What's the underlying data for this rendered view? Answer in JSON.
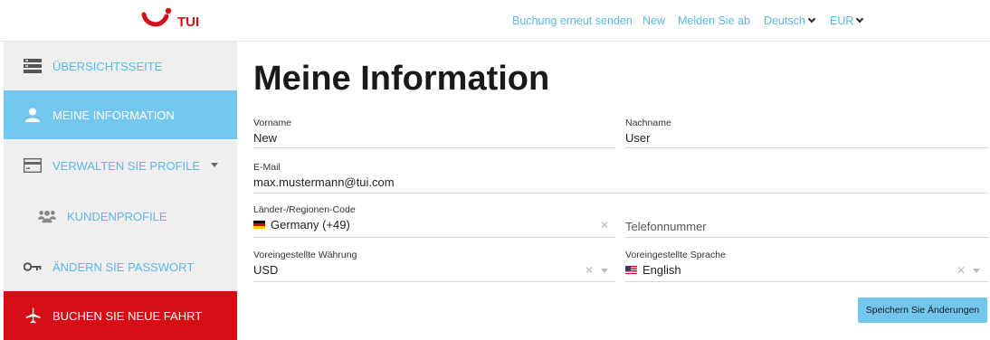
{
  "brand": {
    "name": "TUI",
    "color": "#d40e14"
  },
  "topnav": {
    "resend": "Buchung erneut senden",
    "user": "New",
    "logout": "Melden Sie ab",
    "language": "Deutsch",
    "currency": "EUR"
  },
  "sidebar": {
    "items": [
      {
        "label": "ÜBERSICHTSSEITE",
        "icon": "dashboard-icon"
      },
      {
        "label": "MEINE INFORMATION",
        "icon": "user-icon",
        "active": true
      },
      {
        "label": "VERWALTEN SIE PROFILE",
        "icon": "card-icon"
      },
      {
        "label": "KUNDENPROFILE",
        "icon": "group-icon"
      },
      {
        "label": "ÄNDERN SIE PASSWORT",
        "icon": "key-icon"
      },
      {
        "label": "BUCHEN SIE NEUE FAHRT",
        "icon": "plane-icon"
      }
    ]
  },
  "main": {
    "title": "Meine Information",
    "fields": {
      "first_name": {
        "label": "Vorname",
        "value": "New"
      },
      "last_name": {
        "label": "Nachname",
        "value": "User"
      },
      "email": {
        "label": "E-Mail",
        "value": "max.mustermann@tui.com"
      },
      "country_code": {
        "label": "Länder-/Regionen-Code",
        "value": "Germany (+49)"
      },
      "phone": {
        "placeholder": "Telefonnummer"
      },
      "currency": {
        "label": "Voreingestellte Währung",
        "value": "USD"
      },
      "language": {
        "label": "Voreingestellte Sprache",
        "value": "English"
      }
    },
    "save_label": "Speichern Sie Änderungen"
  },
  "colors": {
    "accent": "#73c6ee",
    "link": "#5bb8e6",
    "cta": "#d40e14"
  }
}
